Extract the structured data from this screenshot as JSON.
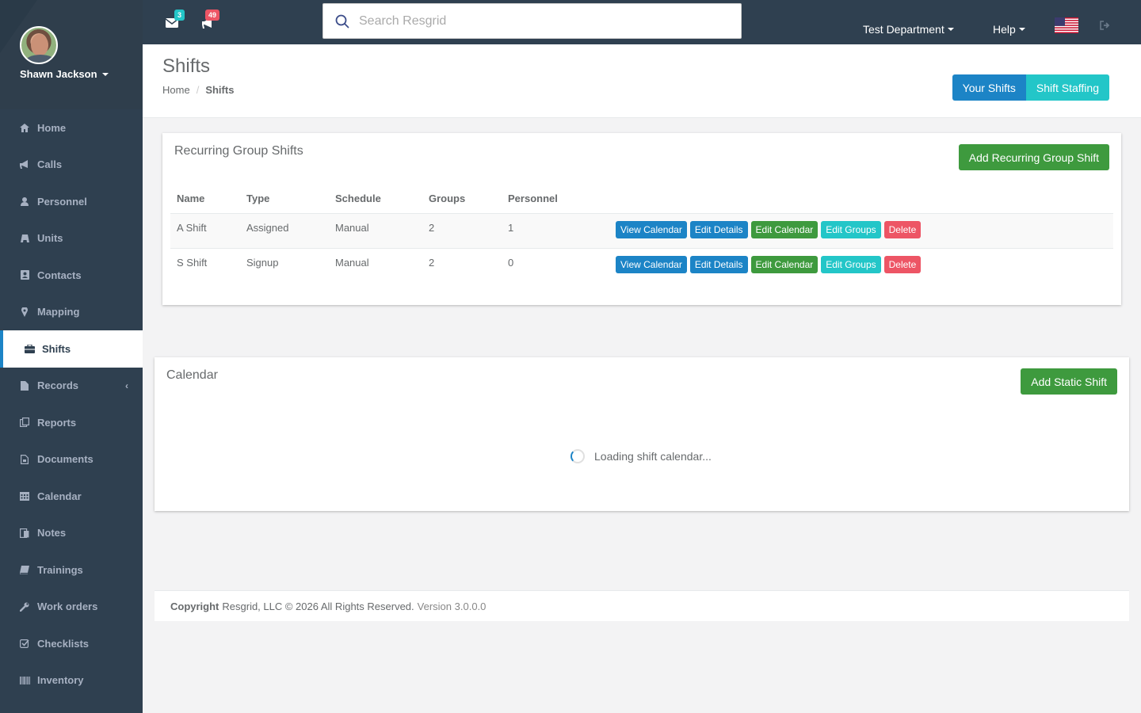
{
  "user": {
    "name": "Shawn Jackson"
  },
  "sidebar": {
    "items": [
      {
        "label": "Home",
        "icon": "home-icon"
      },
      {
        "label": "Calls",
        "icon": "bullhorn-icon"
      },
      {
        "label": "Personnel",
        "icon": "user-icon"
      },
      {
        "label": "Units",
        "icon": "truck-icon"
      },
      {
        "label": "Contacts",
        "icon": "address-book-icon"
      },
      {
        "label": "Mapping",
        "icon": "map-marker-icon"
      },
      {
        "label": "Shifts",
        "icon": "briefcase-icon",
        "active": true
      },
      {
        "label": "Records",
        "icon": "file-icon",
        "has_children": true
      },
      {
        "label": "Reports",
        "icon": "reports-icon"
      },
      {
        "label": "Documents",
        "icon": "document-icon"
      },
      {
        "label": "Calendar",
        "icon": "calendar-icon"
      },
      {
        "label": "Notes",
        "icon": "notes-icon"
      },
      {
        "label": "Trainings",
        "icon": "book-icon"
      },
      {
        "label": "Work orders",
        "icon": "wrench-icon"
      },
      {
        "label": "Checklists",
        "icon": "checkbox-icon"
      },
      {
        "label": "Inventory",
        "icon": "barcode-icon"
      }
    ]
  },
  "topbar": {
    "messages_count": "3",
    "calls_count": "49",
    "search_placeholder": "Search Resgrid",
    "department": "Test Department",
    "help": "Help"
  },
  "page": {
    "title": "Shifts",
    "breadcrumb_home": "Home",
    "breadcrumb_current": "Shifts",
    "your_shifts": "Your Shifts",
    "shift_staffing": "Shift Staffing"
  },
  "recurring": {
    "title": "Recurring Group Shifts",
    "add_label": "Add Recurring Group Shift",
    "columns": [
      "Name",
      "Type",
      "Schedule",
      "Groups",
      "Personnel"
    ],
    "rows": [
      {
        "name": "A Shift",
        "type": "Assigned",
        "schedule": "Manual",
        "groups": "2",
        "personnel": "1"
      },
      {
        "name": "S Shift",
        "type": "Signup",
        "schedule": "Manual",
        "groups": "2",
        "personnel": "0"
      }
    ],
    "actions": {
      "view_calendar": "View Calendar",
      "edit_details": "Edit Details",
      "edit_calendar": "Edit Calendar",
      "edit_groups": "Edit Groups",
      "delete": "Delete"
    }
  },
  "calendar": {
    "title": "Calendar",
    "add_label": "Add Static Shift",
    "loading_text": "Loading shift calendar..."
  },
  "footer": {
    "copyright_label": "Copyright",
    "text": "Resgrid, LLC © 2026 All Rights Reserved.",
    "version": "Version 3.0.0.0"
  },
  "colors": {
    "sidebar_bg": "#2f4050",
    "primary": "#1c84c6",
    "info": "#23c6c8",
    "success": "#3e9a3e",
    "danger": "#ed5565"
  }
}
